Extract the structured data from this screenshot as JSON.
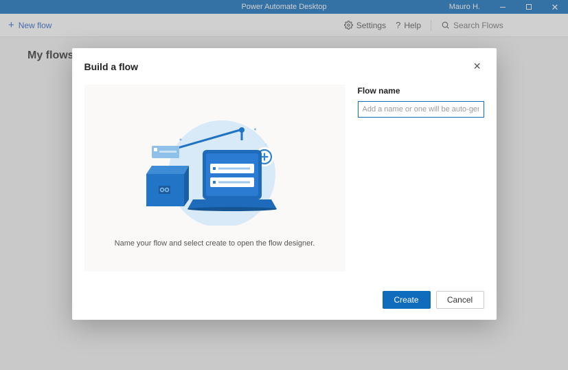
{
  "titlebar": {
    "app_title": "Power Automate Desktop",
    "user_name": "Mauro H."
  },
  "toolbar": {
    "new_flow_label": "New flow",
    "settings_label": "Settings",
    "help_label": "Help",
    "search_placeholder": "Search Flows"
  },
  "page": {
    "title": "My flows"
  },
  "dialog": {
    "title": "Build a flow",
    "hint": "Name your flow and select create to open the flow designer.",
    "field_label": "Flow name",
    "input_value": "",
    "input_placeholder": "Add a name or one will be auto-generated",
    "create_label": "Create",
    "cancel_label": "Cancel"
  },
  "colors": {
    "accent": "#0f6cbd",
    "titlebar": "#106ebe"
  }
}
